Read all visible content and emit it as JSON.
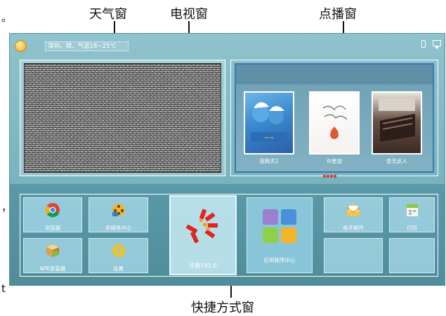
{
  "callouts": {
    "weather": "天气窗",
    "tv": "电视窗",
    "vod": "点播窗",
    "shortcuts": "快捷方式窗",
    "side_marks": [
      "。",
      "，",
      "t"
    ]
  },
  "status_bar": {
    "weather_text": "深圳，晴，气温18~25℃"
  },
  "vod": {
    "items": [
      {
        "title": "蓝精灵2"
      },
      {
        "title": "许愿盒"
      },
      {
        "title": "查无此人"
      }
    ],
    "page_dots": 4
  },
  "shortcuts": {
    "tiles": [
      {
        "label": "浏览器",
        "icon": "chrome-icon"
      },
      {
        "label": "多媒体中心",
        "icon": "film-reel-icon"
      },
      {
        "label": "APK安装器",
        "icon": "package-box-icon"
      },
      {
        "label": "设置",
        "icon": "gear-icon"
      },
      {
        "label": "华数TV2.0",
        "icon": "huashu-logo-icon"
      },
      {
        "label": "应用程序中心",
        "icon": "app-grid-icon"
      },
      {
        "label": "电子邮件",
        "icon": "envelope-icon"
      },
      {
        "label": "日历",
        "icon": "calendar-icon"
      },
      {
        "label": "",
        "icon": ""
      },
      {
        "label": "",
        "icon": ""
      }
    ]
  },
  "colors": {
    "screen_bg": "#7db7c2",
    "tile_bg": "#aadcea",
    "accent_red": "#d33333"
  }
}
